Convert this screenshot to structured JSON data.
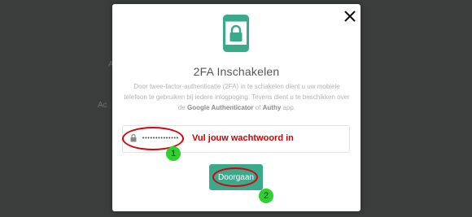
{
  "modal": {
    "title": "2FA Inschakelen",
    "description_part1": "Door twee-factor-authenticatie (2FA) in te schakelen dient u uw mobiele telefoon te gebruiken bij iedere inlogpoging. Tevens dient u te beschikken over de ",
    "description_app1": "Google Authenticator",
    "description_or": " of ",
    "description_app2": "Authy",
    "description_end": " app.",
    "password_value": "••••••••••••••",
    "continue_label": "Doorgaan",
    "close_icon": "close-icon",
    "phone_icon": "phone-lock-icon"
  },
  "annotations": {
    "password_hint": "Vul jouw wachtwoord in",
    "step1": "1",
    "step2": "2"
  },
  "colors": {
    "accent": "#3aa98c",
    "annotation_red": "#d40000",
    "badge_green": "#2fd02f"
  }
}
